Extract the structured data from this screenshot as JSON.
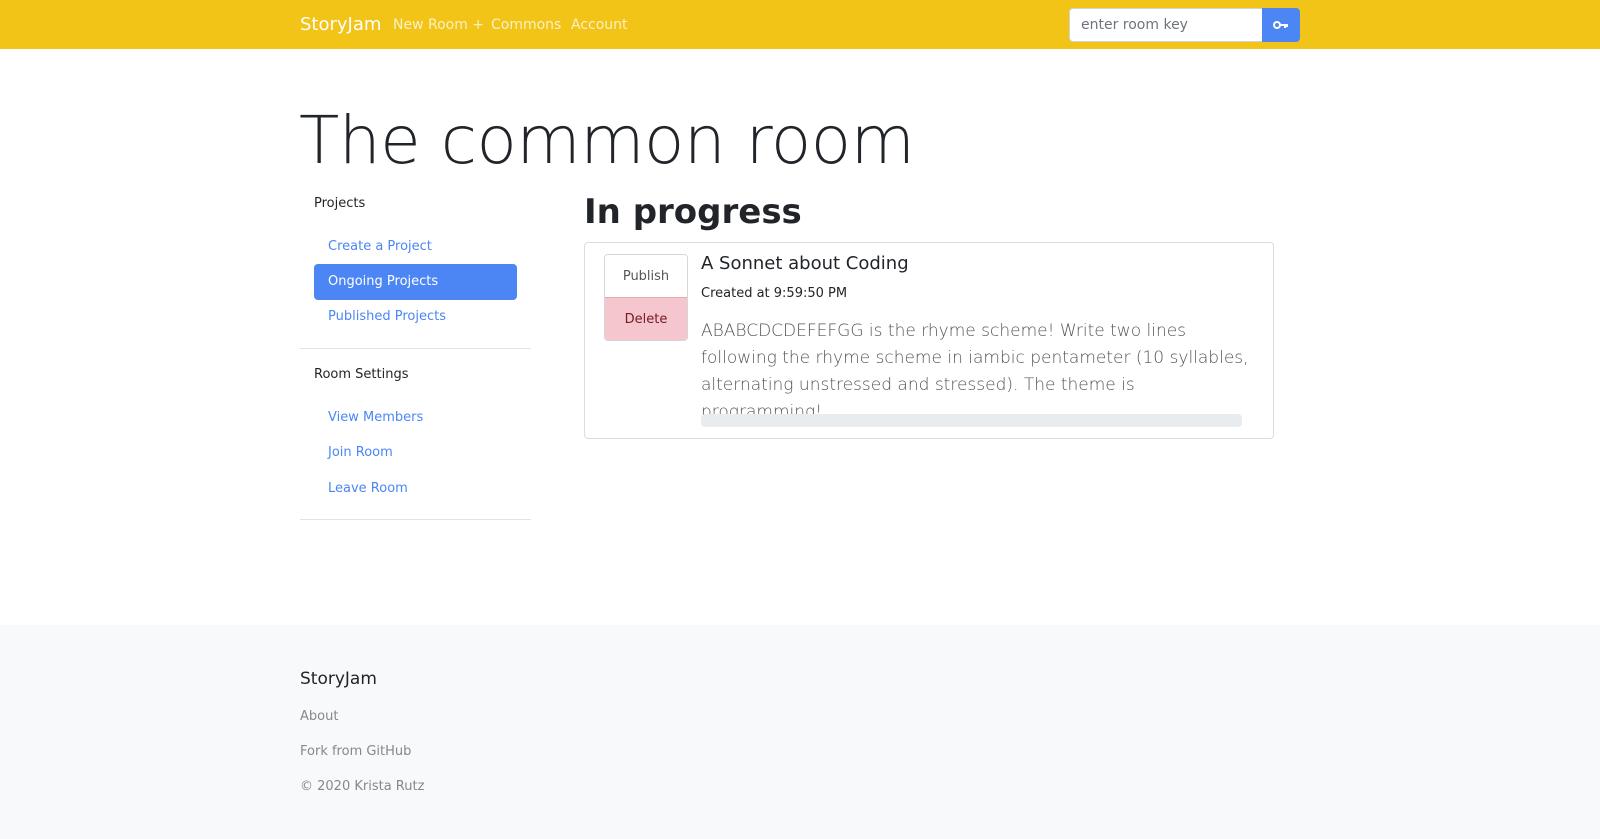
{
  "navbar": {
    "brand": "StoryJam",
    "links": [
      "New Room +",
      "Commons",
      "Account"
    ],
    "search_placeholder": "enter room key",
    "submit_icon": "key-icon",
    "bg_color": "#f2c418",
    "accent_color": "#4c86f5"
  },
  "page": {
    "title": "The common room"
  },
  "sidebar": {
    "projects_heading": "Projects",
    "project_links": [
      "Create a Project",
      "Ongoing Projects",
      "Published Projects"
    ],
    "active_link": "Ongoing Projects",
    "room_heading": "Room Settings",
    "room_links": [
      "View Members",
      "Join Room",
      "Leave Room"
    ]
  },
  "main": {
    "section_title": "In progress",
    "project": {
      "publish_label": "Publish",
      "delete_label": "Delete",
      "title": "A Sonnet about Coding",
      "created": "Created at 9:59:50 PM",
      "description": "ABABCDCDEFEFGG is the rhyme scheme! Write two lines following the rhyme scheme in iambic pentameter (10 syllables, alternating unstressed and stressed). The theme is programming!",
      "progress_percent": 0
    }
  },
  "footer": {
    "brand": "StoryJam",
    "links": [
      "About",
      "Fork from GitHub"
    ],
    "copyright": "© 2020 Krista Rutz"
  }
}
